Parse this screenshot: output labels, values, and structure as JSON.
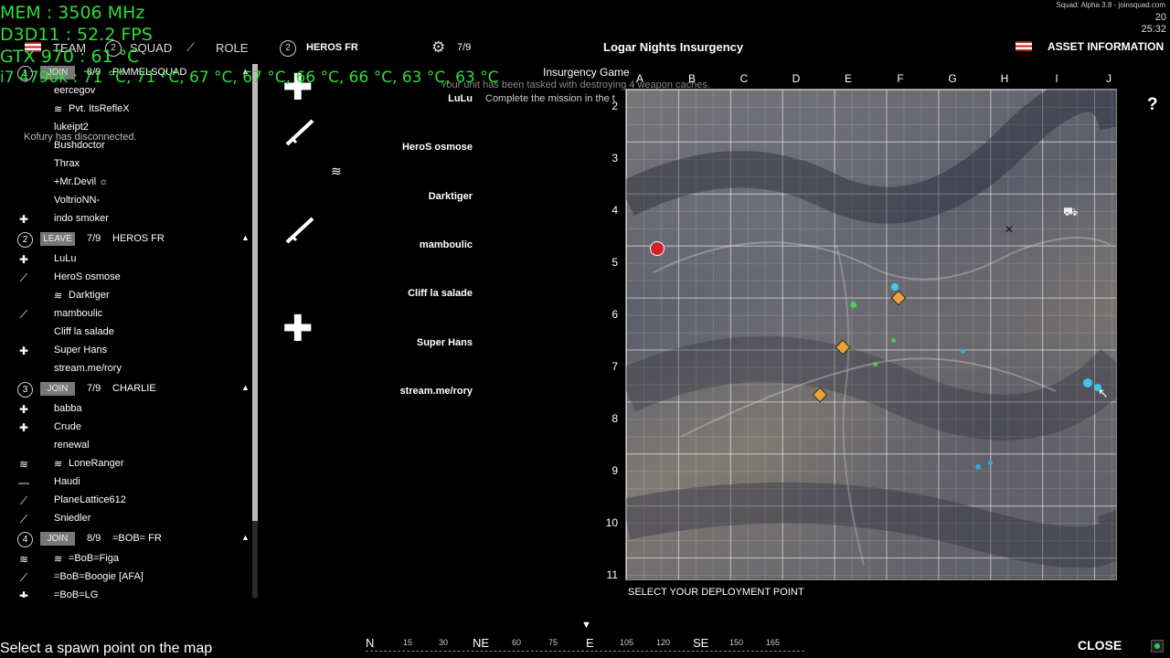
{
  "game_title": "Squad: Alpha 3.8 - joinsquad.com",
  "clock": {
    "hour": "20",
    "minute": "25:32"
  },
  "perf_overlay": {
    "mem": "MEM      : 3506 MHz",
    "d3d": "D3D11      : 52.2 FPS",
    "gpu": "GTX 970   : 61 °C",
    "cpu": "i7 4790k  : 71 °C, 71 °C, 67 °C, 67 °C, 66 °C, 66 °C, 63 °C, 63 °C"
  },
  "top_bar": {
    "team_label": "TEAM",
    "squad_num": "2",
    "squad_label": "SQUAD",
    "role_label": "ROLE",
    "heros_num": "2",
    "heros_label": "HEROS FR",
    "gear_count": "7/9",
    "map_title": "Logar Nights Insurgency",
    "asset_info": "ASSET INFORMATION"
  },
  "notice": {
    "mode": "Insurgency Game",
    "task": "Your unit has been tasked with destroying 4 weapon caches.",
    "complete": "Complete the mission in the t",
    "disconnect": "Kofury has disconnected."
  },
  "squad_list": {
    "squad1": {
      "num": "1",
      "btn": "JOIN",
      "count": "8/9",
      "name": "PIMMELSQUAD"
    },
    "squad1_members": [
      "eercegov",
      "Pvt. ItsRefleX",
      "lukeipt2",
      "Bushdoctor",
      "Thrax",
      "+Mr.Devil ☼",
      "VoltrioNN-",
      "indo smoker"
    ],
    "squad2": {
      "num": "2",
      "btn": "LEAVE",
      "count": "7/9",
      "name": "HEROS FR"
    },
    "squad2_members": [
      "LuLu",
      "HeroS osmose",
      "Darktiger",
      "mamboulic",
      "Cliff la salade",
      "Super Hans",
      "stream.me/rory"
    ],
    "squad3": {
      "num": "3",
      "btn": "JOIN",
      "count": "7/9",
      "name": "CHARLIE"
    },
    "squad3_members": [
      "babba",
      "Crude",
      "renewal",
      "LoneRanger",
      "Haudi",
      "PlaneLattice612",
      "Sniedler"
    ],
    "squad4": {
      "num": "4",
      "btn": "JOIN",
      "count": "8/9",
      "name": "=BOB= FR"
    },
    "squad4_members": [
      "=BoB=Figa",
      "=BoB=Boogie [AFA]",
      "=BoB=LG"
    ]
  },
  "squad_detail": {
    "members": [
      "LuLu",
      "HeroS osmose",
      "Darktiger",
      "mamboulic",
      "Cliff la salade",
      "Super Hans",
      "stream.me/rory"
    ]
  },
  "map": {
    "columns": [
      "A",
      "B",
      "C",
      "D",
      "E",
      "F",
      "G",
      "H",
      "I",
      "J"
    ],
    "rows": [
      "2",
      "3",
      "4",
      "5",
      "6",
      "7",
      "8",
      "9",
      "10",
      "11"
    ],
    "deploy_label": "SELECT YOUR DEPLOYMENT POINT",
    "help": "?"
  },
  "compass": {
    "labels": [
      "N",
      "15",
      "30",
      "NE",
      "60",
      "75",
      "E",
      "105",
      "120",
      "SE",
      "150",
      "165"
    ]
  },
  "bottom": {
    "spawn_hint": "Select a spawn point on the map",
    "close": "CLOSE"
  },
  "colors": {
    "overlay_green": "#2fdc3a",
    "marker_orange": "#e8a23c",
    "marker_red": "#d2222a",
    "status_green": "#2ecc40"
  }
}
